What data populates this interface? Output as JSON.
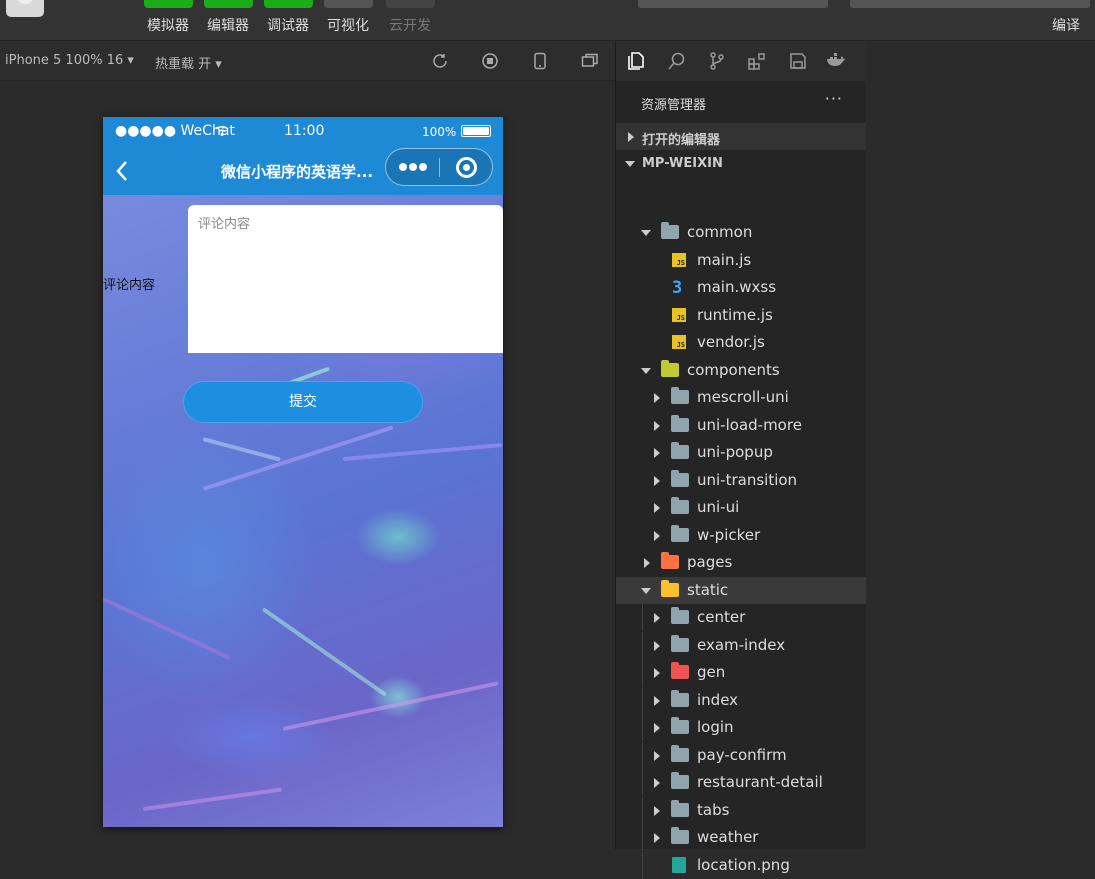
{
  "toolbar": {
    "buttons": [
      {
        "label": "模拟器",
        "bar_color": "#1aad19"
      },
      {
        "label": "编辑器",
        "bar_color": "#1aad19"
      },
      {
        "label": "调试器",
        "bar_color": "#1aad19"
      },
      {
        "label": "可视化",
        "bar_color": "#555555"
      },
      {
        "label": "云开发",
        "bar_color": "#444444"
      }
    ],
    "compile_label": "编译"
  },
  "simulator": {
    "device_select": "iPhone 5 100% 16 ▾",
    "hot_reload": "热重载 开 ▾",
    "status": {
      "carrier": "●●●●● WeChat",
      "time": "11:00",
      "battery": "100%"
    },
    "nav_title": "微信小程序的英语学...",
    "page": {
      "side_label": "评论内容",
      "textarea_placeholder": "评论内容",
      "submit_label": "提交"
    }
  },
  "explorer": {
    "title": "资源管理器",
    "more": "···",
    "sections": {
      "open_editors": "打开的编辑器",
      "project": "MP-WEIXIN"
    },
    "tree": [
      {
        "name": "common",
        "depth": 1,
        "kind": "folder-open",
        "color": "#90a4ae"
      },
      {
        "name": "main.js",
        "depth": 2,
        "kind": "js"
      },
      {
        "name": "main.wxss",
        "depth": 2,
        "kind": "css"
      },
      {
        "name": "runtime.js",
        "depth": 2,
        "kind": "js"
      },
      {
        "name": "vendor.js",
        "depth": 2,
        "kind": "js"
      },
      {
        "name": "components",
        "depth": 1,
        "kind": "folder-open",
        "color": "#c0ca33"
      },
      {
        "name": "mescroll-uni",
        "depth": 2,
        "kind": "folder",
        "color": "#90a4ae"
      },
      {
        "name": "uni-load-more",
        "depth": 2,
        "kind": "folder",
        "color": "#90a4ae"
      },
      {
        "name": "uni-popup",
        "depth": 2,
        "kind": "folder",
        "color": "#90a4ae"
      },
      {
        "name": "uni-transition",
        "depth": 2,
        "kind": "folder",
        "color": "#90a4ae"
      },
      {
        "name": "uni-ui",
        "depth": 2,
        "kind": "folder",
        "color": "#90a4ae"
      },
      {
        "name": "w-picker",
        "depth": 2,
        "kind": "folder",
        "color": "#90a4ae"
      },
      {
        "name": "pages",
        "depth": 1,
        "kind": "folder",
        "color": "#ff7043"
      },
      {
        "name": "static",
        "depth": 1,
        "kind": "folder-open",
        "color": "#fbc02d",
        "selected": true
      },
      {
        "name": "center",
        "depth": 2,
        "kind": "folder",
        "color": "#90a4ae"
      },
      {
        "name": "exam-index",
        "depth": 2,
        "kind": "folder",
        "color": "#90a4ae"
      },
      {
        "name": "gen",
        "depth": 2,
        "kind": "folder",
        "color": "#ef5350"
      },
      {
        "name": "index",
        "depth": 2,
        "kind": "folder",
        "color": "#90a4ae"
      },
      {
        "name": "login",
        "depth": 2,
        "kind": "folder",
        "color": "#90a4ae"
      },
      {
        "name": "pay-confirm",
        "depth": 2,
        "kind": "folder",
        "color": "#90a4ae"
      },
      {
        "name": "restaurant-detail",
        "depth": 2,
        "kind": "folder",
        "color": "#90a4ae"
      },
      {
        "name": "tabs",
        "depth": 2,
        "kind": "folder",
        "color": "#90a4ae"
      },
      {
        "name": "weather",
        "depth": 2,
        "kind": "folder",
        "color": "#90a4ae"
      },
      {
        "name": "location.png",
        "depth": 2,
        "kind": "png"
      }
    ]
  }
}
